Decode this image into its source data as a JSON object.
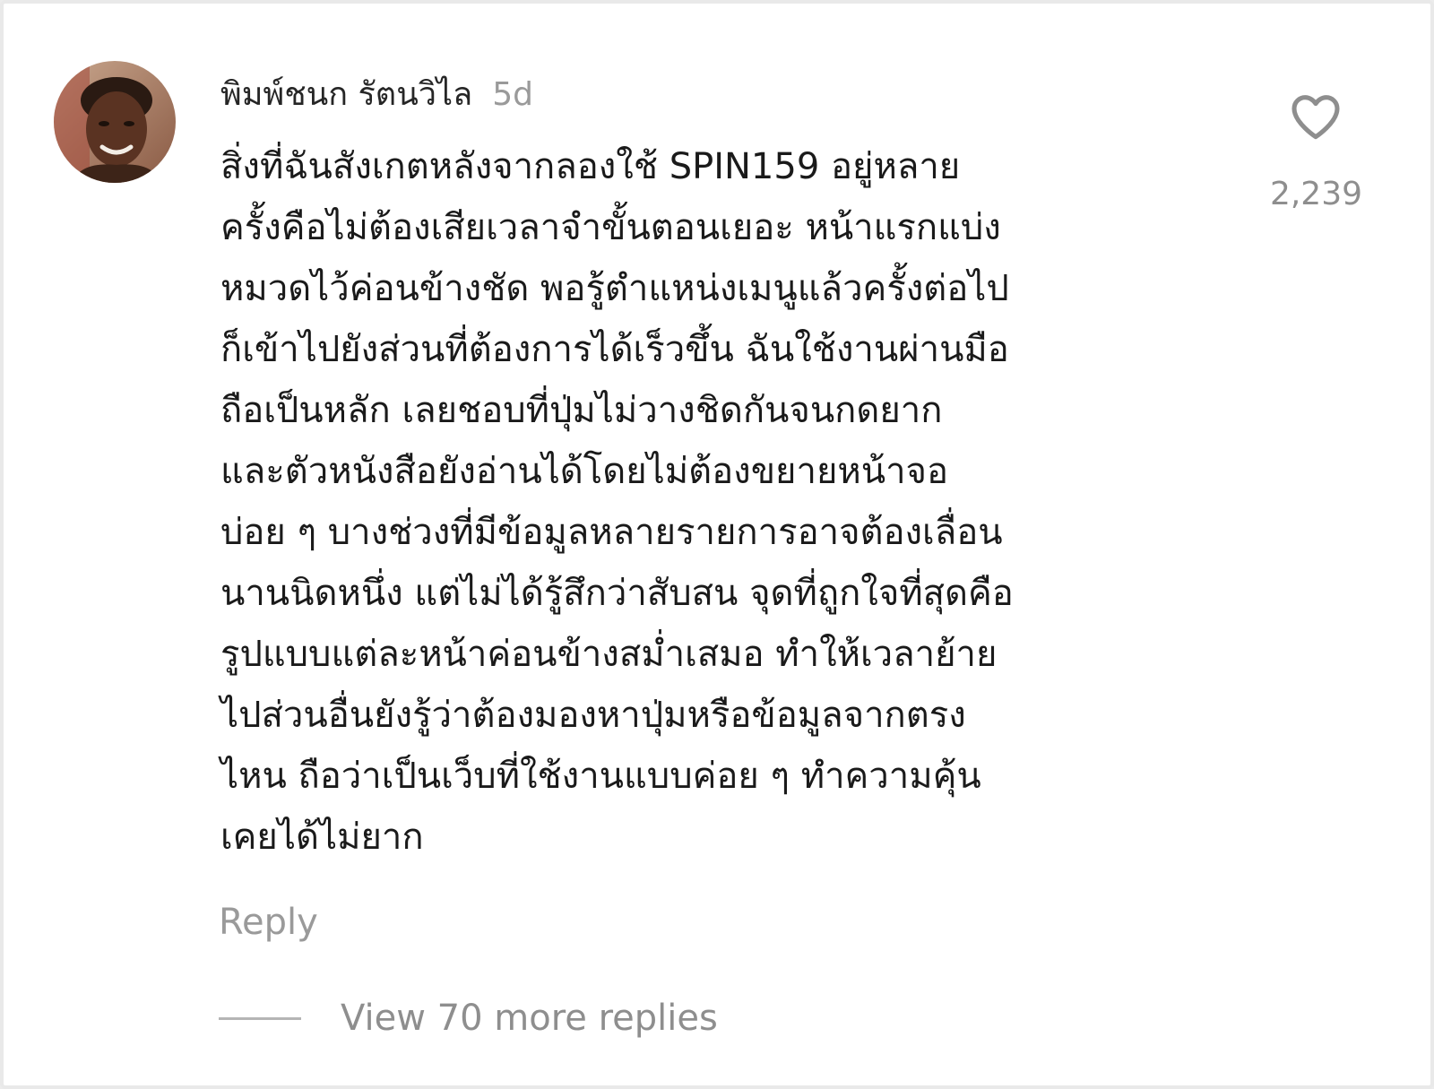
{
  "comment": {
    "username": "พิมพ์ชนก รัตนวิไล",
    "time_ago": "5d",
    "text_lines": [
      "สิ่งที่ฉันสังเกตหลังจากลองใช้ SPIN159 อยู่หลาย",
      "ครั้งคือไม่ต้องเสียเวลาจำขั้นตอนเยอะ หน้าแรกแบ่ง",
      "หมวดไว้ค่อนข้างชัด พอรู้ตำแหน่งเมนูแล้วครั้งต่อไป",
      "ก็เข้าไปยังส่วนที่ต้องการได้เร็วขึ้น ฉันใช้งานผ่านมือ",
      "ถือเป็นหลัก เลยชอบที่ปุ่มไม่วางชิดกันจนกดยาก",
      "และตัวหนังสือยังอ่านได้โดยไม่ต้องขยายหน้าจอ",
      "บ่อย ๆ บางช่วงที่มีข้อมูลหลายรายการอาจต้องเลื่อน",
      "นานนิดหนึ่ง แต่ไม่ได้รู้สึกว่าสับสน จุดที่ถูกใจที่สุดคือ",
      "รูปแบบแต่ละหน้าค่อนข้างสม่ำเสมอ ทำให้เวลาย้าย",
      "ไปส่วนอื่นยังรู้ว่าต้องมองหาปุ่มหรือข้อมูลจากตรง",
      "ไหน ถือว่าเป็นเว็บที่ใช้งานแบบค่อย ๆ ทำความคุ้น",
      "เคยได้ไม่ยาก"
    ],
    "like_icon": "heart-outline-icon",
    "like_count": "2,239",
    "reply_label": "Reply",
    "view_replies_label": "View 70 more replies"
  },
  "colors": {
    "username": "#262626",
    "body_text": "#1a1a1a",
    "muted": "#9a9a9a",
    "heart": "#8e8e8e"
  }
}
